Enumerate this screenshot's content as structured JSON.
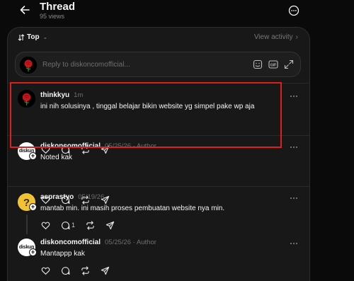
{
  "header": {
    "title": "Thread",
    "views": "95 views"
  },
  "sortbar": {
    "sort_label": "Top",
    "view_activity": "View activity"
  },
  "reply": {
    "placeholder": "Reply to diskoncomofficial..."
  },
  "posts": [
    {
      "username": "thinkkyu",
      "time": "1m",
      "author_tag": "",
      "text": "ini nih solusinya , tinggal belajar bikin website yg simpel pake wp aja",
      "reply_count": ""
    },
    {
      "username": "diskoncomofficial",
      "time": "05/25/26",
      "author_tag": "Author",
      "text": "Noted kak",
      "reply_count": ""
    },
    {
      "username": "asprastyo",
      "time": "05/19/26",
      "author_tag": "",
      "text": "mantab min. ini masih proses pembuatan website nya min.",
      "reply_count": "1"
    },
    {
      "username": "diskoncomofficial",
      "time": "05/25/26",
      "author_tag": "Author",
      "text": "Mantappp kak",
      "reply_count": ""
    }
  ],
  "avatar_labels": {
    "disk": "diskun"
  },
  "icons": {
    "back": "arrow-left-icon",
    "more": "more-circle-icon",
    "sort": "sort-icon",
    "sticker": "sticker-icon",
    "gif": "gif-icon",
    "expand": "expand-icon",
    "like": "heart-icon",
    "reply": "comment-icon",
    "repost": "repost-icon",
    "share": "send-icon"
  },
  "colors": {
    "background": "#0a0a0a",
    "panel": "#181818",
    "highlight": "#e01e1e",
    "text": "#f3f5f7",
    "muted": "#6f6f6f"
  }
}
